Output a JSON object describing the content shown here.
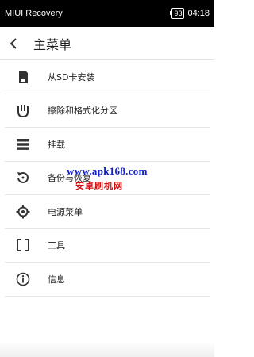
{
  "status_bar": {
    "app_name": "MIUI Recovery",
    "battery": "93",
    "time": "04:18"
  },
  "header": {
    "title": "主菜单"
  },
  "menu": {
    "items": [
      {
        "label": "从SD卡安装",
        "icon": "sd-card-icon"
      },
      {
        "label": "擦除和格式化分区",
        "icon": "wipe-hand-icon"
      },
      {
        "label": "挂载",
        "icon": "storage-icon"
      },
      {
        "label": "备份与恢复",
        "icon": "backup-restore-icon"
      },
      {
        "label": "电源菜单",
        "icon": "power-gear-icon"
      },
      {
        "label": "工具",
        "icon": "brackets-icon"
      },
      {
        "label": "信息",
        "icon": "info-icon"
      }
    ]
  },
  "watermark": {
    "url": "www.apk168.com",
    "site": "安卓刷机网"
  }
}
